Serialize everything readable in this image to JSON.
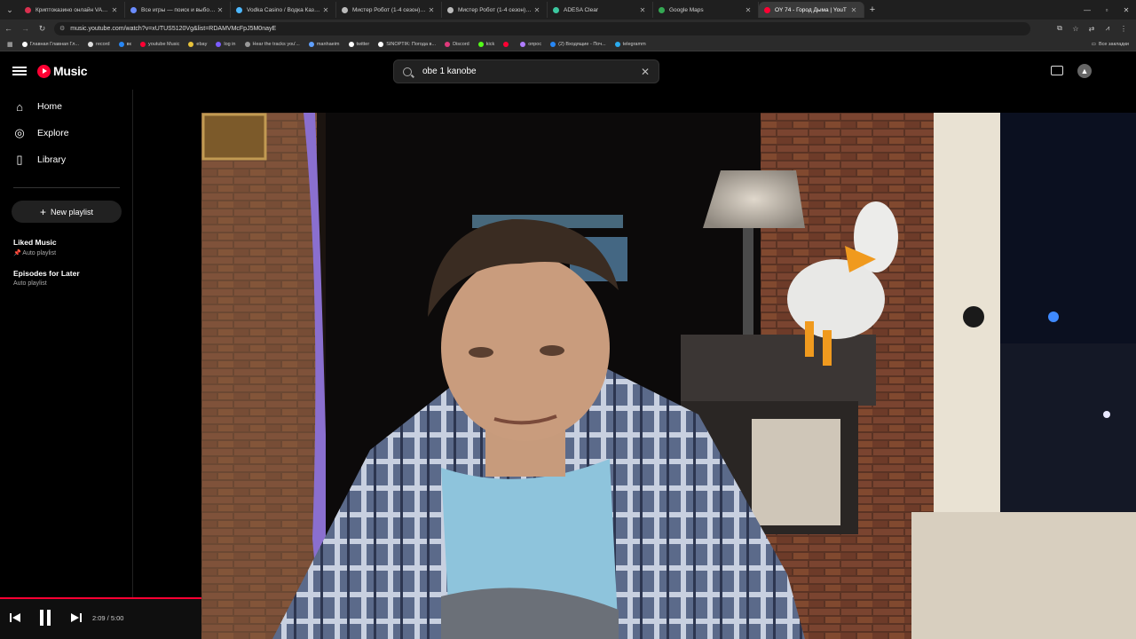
{
  "browser": {
    "tabs": [
      {
        "title": "Криптоказино онлайн VAWADA",
        "color": "#d9304f",
        "active": false
      },
      {
        "title": "Все игры — поиск и выбор и",
        "color": "#6a8cff",
        "active": false
      },
      {
        "title": "Vodka Casino / Водка Казино",
        "color": "#4db8ff",
        "active": false
      },
      {
        "title": "Мистер Робот (1-4 сезон) смо",
        "color": "#bbbbbb",
        "active": false
      },
      {
        "title": "Мистер Робот (1-4 сезон) смо",
        "color": "#bbbbbb",
        "active": false
      },
      {
        "title": "ADESA Clear",
        "color": "#3cc8a0",
        "active": false
      },
      {
        "title": "Google Maps",
        "color": "#34a853",
        "active": false
      },
      {
        "title": "OY 74 - Город Дыма | YouT",
        "color": "#ff0033",
        "active": true
      }
    ],
    "url": "music.youtube.com/watch?v=xUTUS5120Vg&list=RDAMVMcFpJ5M0nayE",
    "bookmarks": [
      {
        "label": "Главная Главная Гл...",
        "color": "#ffffff"
      },
      {
        "label": "record",
        "color": "#dddddd"
      },
      {
        "label": "вк",
        "color": "#2787f5"
      },
      {
        "label": "youtube Music",
        "color": "#ff0033"
      },
      {
        "label": "ebay",
        "color": "#e8c33a"
      },
      {
        "label": "log in",
        "color": "#7b5cff"
      },
      {
        "label": "Hear the tracks you'...",
        "color": "#999999"
      },
      {
        "label": "manhaeim",
        "color": "#5fa0ff"
      },
      {
        "label": "twitter",
        "color": "#ffffff"
      },
      {
        "label": "SINOPTIK: Погода в...",
        "color": "#ffffff"
      },
      {
        "label": "Discord",
        "color": "#e0397b"
      },
      {
        "label": "kick",
        "color": "#53fc18"
      },
      {
        "label": "",
        "color": "#ff0033"
      },
      {
        "label": "опрос",
        "color": "#b07cff"
      },
      {
        "label": "(2) Входящие - Поч...",
        "color": "#2787f5"
      },
      {
        "label": "telegramm",
        "color": "#2aabee"
      }
    ],
    "all_bookmarks": "Все закладки"
  },
  "app": {
    "logo": "Music",
    "search_query": "obe 1 kanobe",
    "nav": [
      {
        "label": "Home",
        "icon": "home-icon"
      },
      {
        "label": "Explore",
        "icon": "compass-icon"
      },
      {
        "label": "Library",
        "icon": "bookmark-icon"
      }
    ],
    "new_playlist": "New playlist",
    "playlists": [
      {
        "title": "Liked Music",
        "subtitle": "Auto playlist"
      },
      {
        "title": "Episodes for Later",
        "subtitle": "Auto playlist"
      }
    ],
    "player": {
      "time": "2:09 / 5:00",
      "progress": 0.43
    }
  }
}
